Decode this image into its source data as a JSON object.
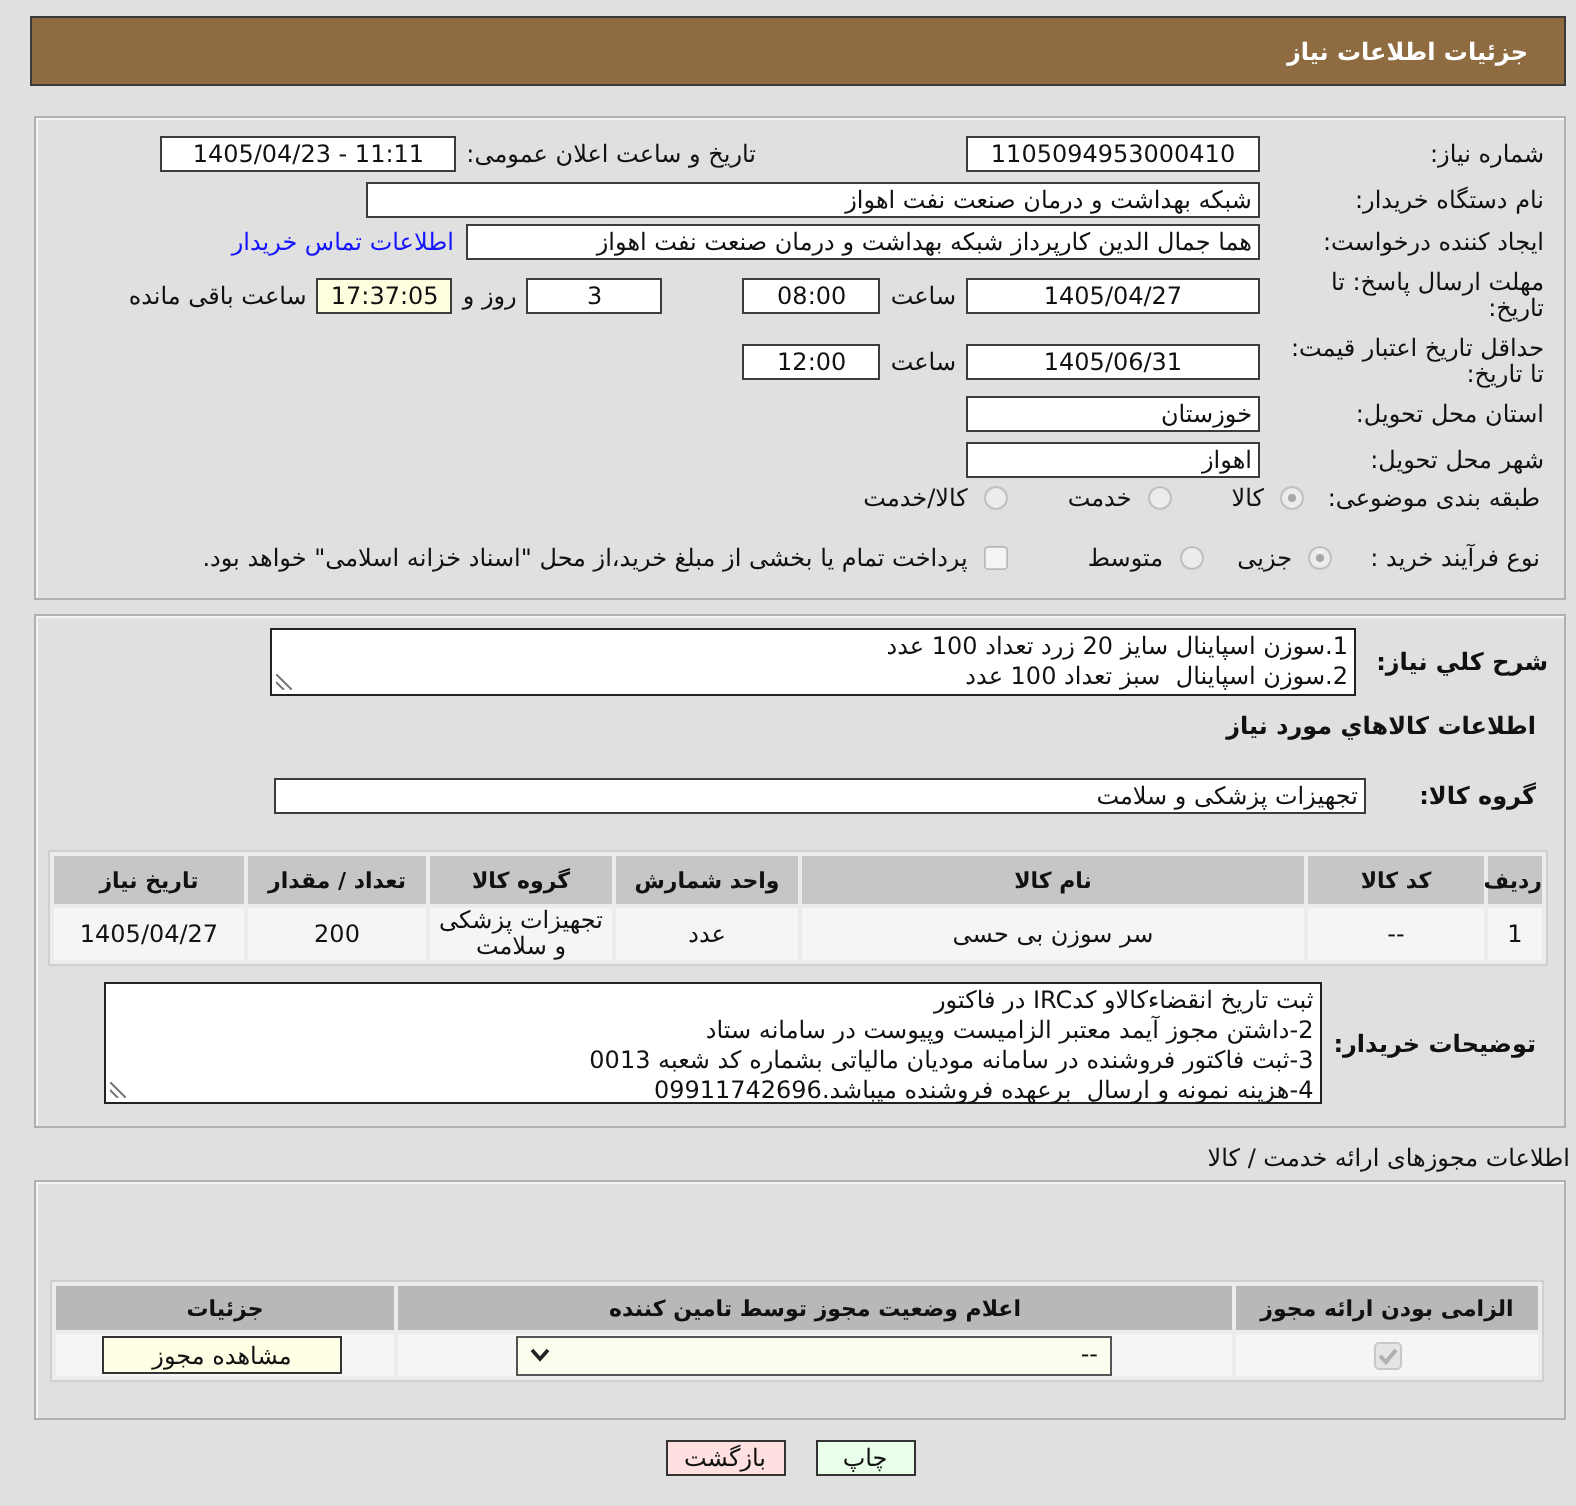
{
  "header": {
    "title": "جزئیات اطلاعات نیاز"
  },
  "need_info": {
    "need_number": {
      "label": "شماره نیاز:",
      "value": "1105094953000410"
    },
    "announce": {
      "label": "تاریخ و ساعت اعلان عمومی:",
      "value": "1405/04/23 - 11:11"
    },
    "buyer_org": {
      "label": "نام دستگاه خریدار:",
      "value": "شبکه بهداشت و درمان صنعت نفت اهواز"
    },
    "requester": {
      "label": "ایجاد کننده درخواست:",
      "value": "هما جمال الدین کارپرداز شبکه بهداشت و درمان صنعت نفت اهواز",
      "link": "اطلاعات تماس خریدار"
    },
    "response_deadline": {
      "label": "مهلت ارسال پاسخ: تا تاریخ:",
      "date": "1405/04/27",
      "time_label": "ساعت",
      "time": "08:00",
      "days": "3",
      "days_label": "روز و",
      "remaining": "17:37:05",
      "remaining_label": "ساعت باقی مانده"
    },
    "price_validity": {
      "label": "حداقل تاریخ اعتبار قیمت: تا تاریخ:",
      "date": "1405/06/31",
      "time_label": "ساعت",
      "time": "12:00"
    },
    "province": {
      "label": "استان محل تحویل:",
      "value": "خوزستان"
    },
    "city": {
      "label": "شهر محل تحویل:",
      "value": "اهواز"
    },
    "category": {
      "label": "طبقه بندی موضوعی:",
      "options": [
        {
          "label": "کالا",
          "selected": true
        },
        {
          "label": "خدمت",
          "selected": false
        },
        {
          "label": "کالا/خدمت",
          "selected": false
        }
      ]
    },
    "purchase_type": {
      "label": "نوع فرآیند خرید :",
      "options": [
        {
          "label": "جزیی",
          "selected": true
        },
        {
          "label": "متوسط",
          "selected": false
        }
      ],
      "treasury_payment": {
        "label": "پرداخت تمام یا بخشی از مبلغ خرید،از محل \"اسناد خزانه اسلامی\" خواهد بود.",
        "checked": false
      }
    }
  },
  "description": {
    "label": "شرح کلي نياز:",
    "lines": [
      "1.سوزن اسپاینال سایز 20 زرد تعداد 100 عدد",
      "2.سوزن اسپاینال  سبز تعداد 100 عدد"
    ]
  },
  "goods": {
    "title": "اطلاعات كالاهاي مورد نياز",
    "group_label": "گروه کالا:",
    "group_value": "تجهیزات پزشکی و سلامت",
    "table": {
      "columns": [
        "ردیف",
        "کد کالا",
        "نام کالا",
        "واحد شمارش",
        "گروه کالا",
        "تعداد / مقدار",
        "تاریخ نیاز"
      ],
      "rows": [
        [
          "1",
          "--",
          "سر سوزن بی حسی",
          "عدد",
          "تجهیزات پزشکی و سلامت",
          "200",
          "1405/04/27"
        ]
      ]
    }
  },
  "buyer_notes": {
    "label": "توضیحات خریدار:",
    "lines": [
      "ثبت تاریخ انقضاءکالاو کدIRC در فاکتور",
      "2-داشتن مجوز آیمد معتبر الزامیست وپیوست در سامانه ستاد",
      "3-ثبت فاکتور فروشنده در سامانه مودیان مالیاتی بشماره کد شعبه 0013",
      "4-هزینه نمونه و ارسال  برعهده فروشنده میباشد.09911742696"
    ]
  },
  "permits": {
    "title": "اطلاعات مجوزهای ارائه خدمت / کالا",
    "table": {
      "columns": [
        "الزامی بودن ارائه مجوز",
        "اعلام وضعیت مجوز توسط تامین کننده",
        "جزئیات"
      ],
      "rows": [
        {
          "required": true,
          "status": "--",
          "action": "مشاهده مجوز"
        }
      ]
    }
  },
  "buttons": [
    {
      "label": "چاپ",
      "kind": "print"
    },
    {
      "label": "بازگشت",
      "kind": "back"
    }
  ]
}
